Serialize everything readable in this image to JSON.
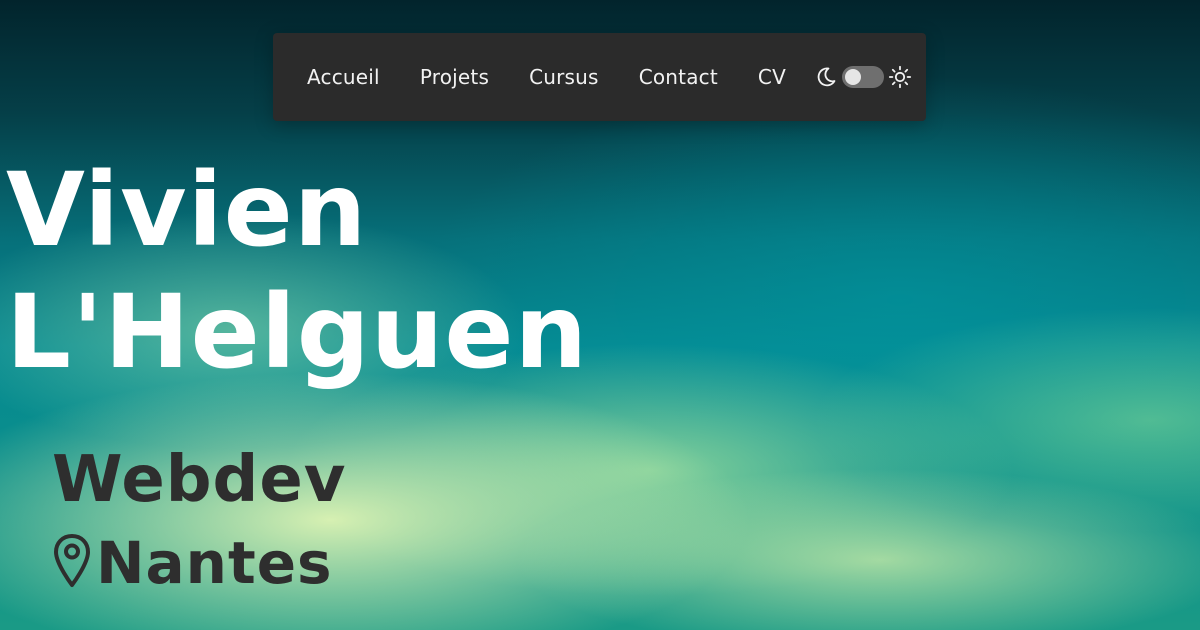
{
  "nav": {
    "links": [
      "Accueil",
      "Projets",
      "Cursus",
      "Contact",
      "CV"
    ],
    "theme_toggle": {
      "left_icon": "moon-icon",
      "right_icon": "sun-icon",
      "state": "dark"
    }
  },
  "hero": {
    "first_name": "Vivien",
    "last_name": "L'Helguen",
    "role": "Webdev",
    "location": "Nantes",
    "location_icon": "map-pin-icon"
  },
  "colors": {
    "navbar_bg": "#2b2b2b",
    "name_text": "#ffffff",
    "subtitle_text": "#2e2e2e"
  }
}
